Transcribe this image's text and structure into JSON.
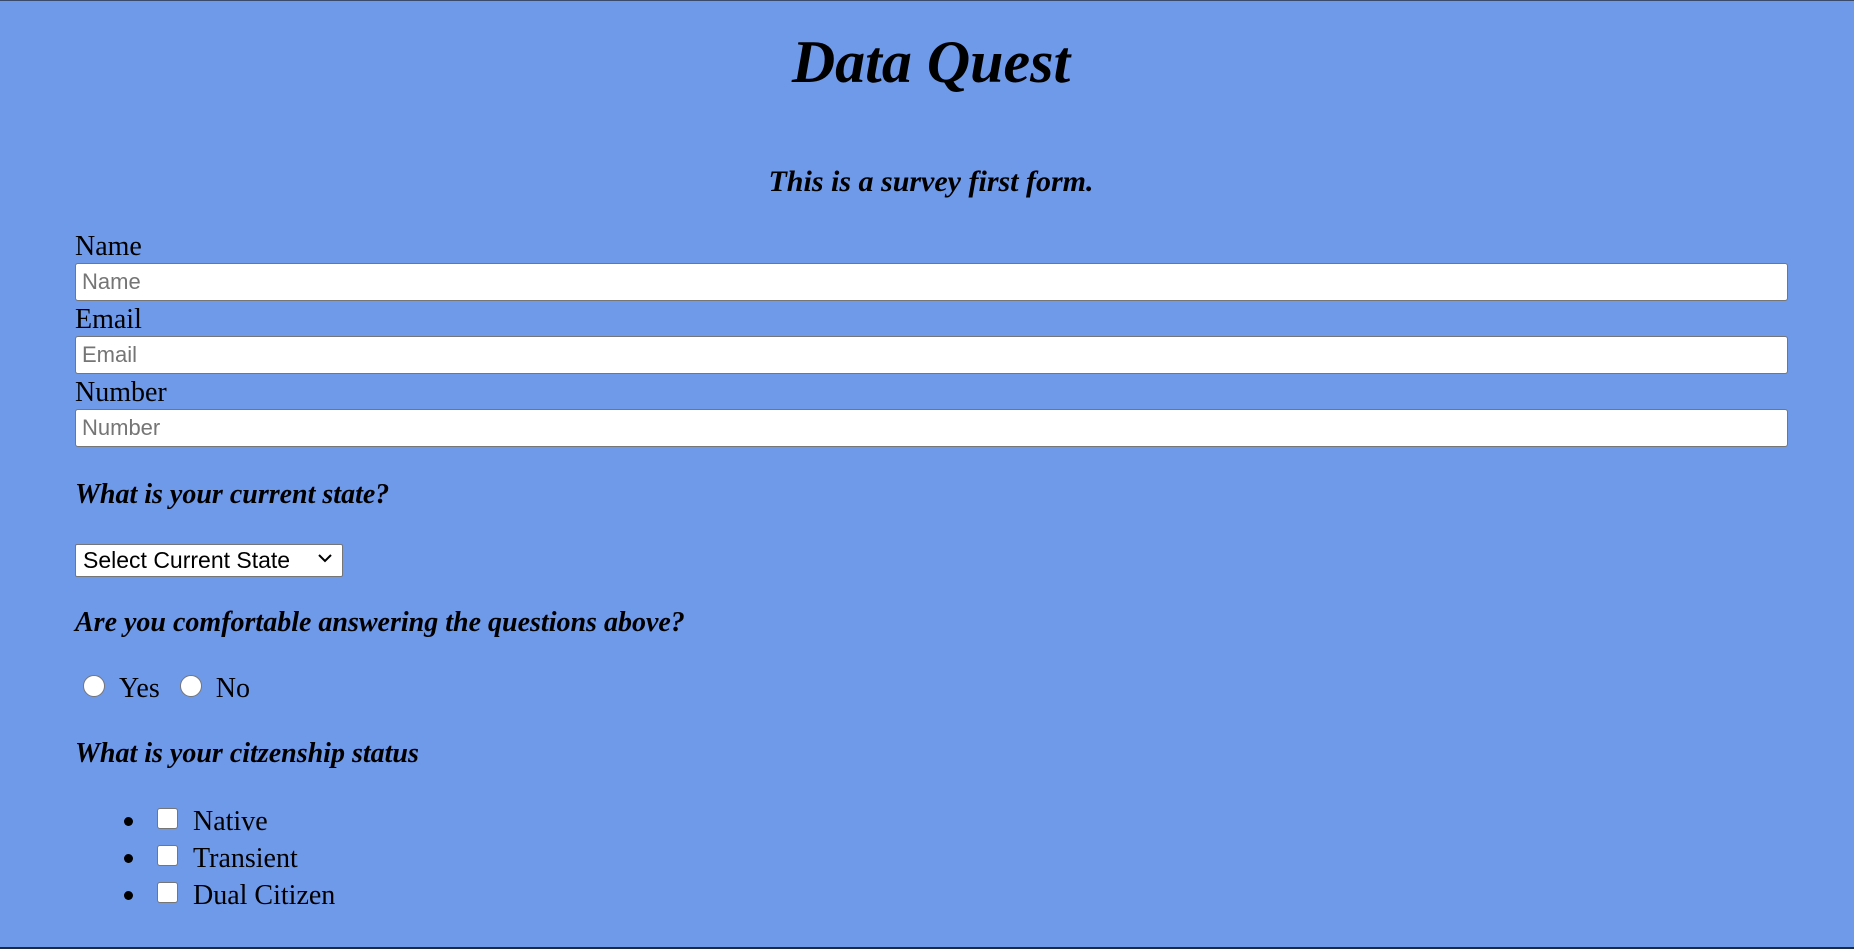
{
  "page": {
    "title": "Data Quest",
    "subtitle": "This is a survey first form."
  },
  "form": {
    "name": {
      "label": "Name",
      "placeholder": "Name",
      "value": ""
    },
    "email": {
      "label": "Email",
      "placeholder": "Email",
      "value": ""
    },
    "number": {
      "label": "Number",
      "placeholder": "Number",
      "value": ""
    },
    "state_question": "What is your current state?",
    "state_select": {
      "selected": "Select Current State"
    },
    "comfort_question": "Are you comfortable answering the questions above?",
    "comfort_options": [
      {
        "label": "Yes",
        "checked": false
      },
      {
        "label": "No",
        "checked": false
      }
    ],
    "citizenship_question": "What is your citzenship status",
    "citizenship_options": [
      {
        "label": "Native",
        "checked": false
      },
      {
        "label": "Transient",
        "checked": false
      },
      {
        "label": "Dual Citizen",
        "checked": false
      }
    ]
  },
  "colors": {
    "background": "#6f99e9",
    "input_background": "#ffffff",
    "input_border": "#767676"
  },
  "icons": {
    "select_arrow": "chevron-down-icon"
  }
}
